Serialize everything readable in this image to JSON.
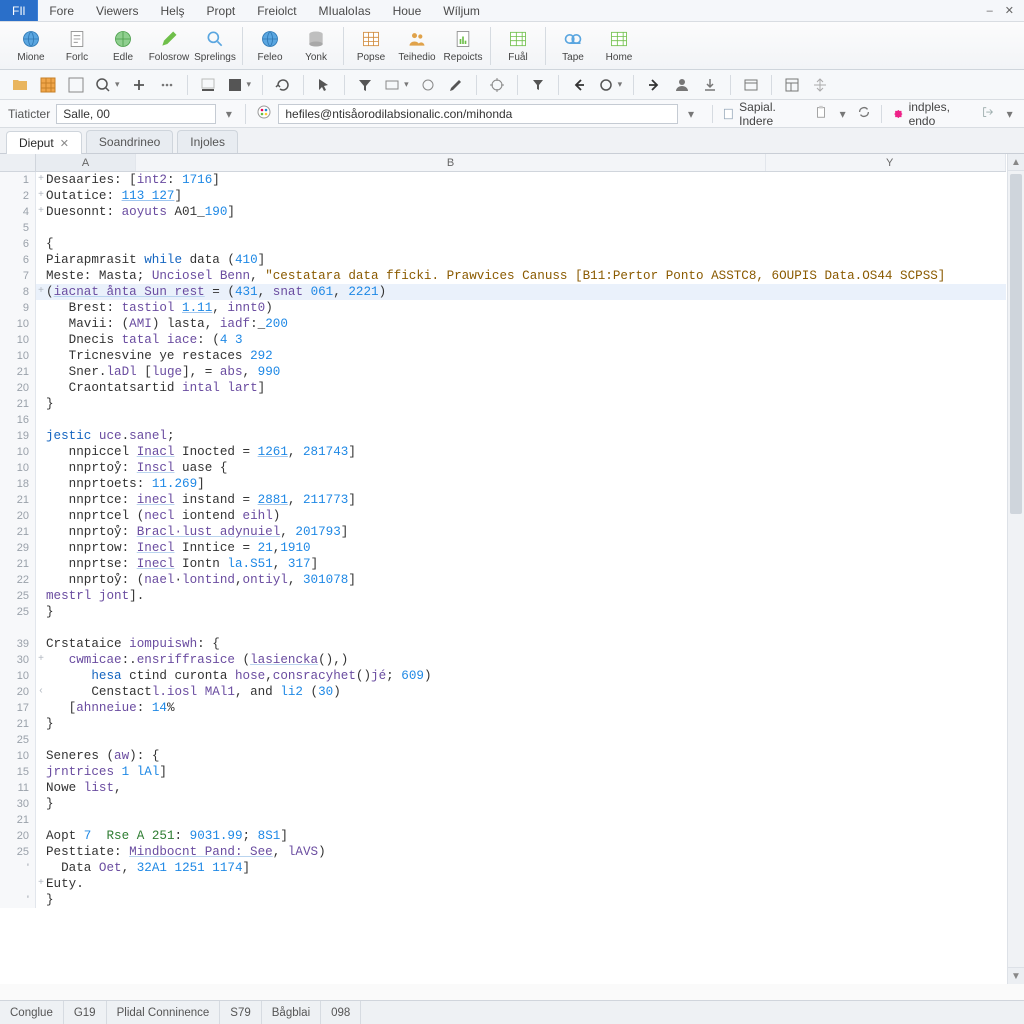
{
  "menu": {
    "file": "FIl",
    "items": [
      "Fore",
      "Viewers",
      "Helş",
      "Propt",
      "Freiolct",
      "MIualoIas",
      "Houe",
      "Wíljum"
    ]
  },
  "ribbon": [
    {
      "label": "Mione",
      "icon": "globe"
    },
    {
      "label": "Forlc",
      "icon": "doc"
    },
    {
      "label": "Edle",
      "icon": "globe2"
    },
    {
      "label": "Folosrow",
      "icon": "pen"
    },
    {
      "label": "Sprelings",
      "icon": "search"
    },
    {
      "label": "Feleo",
      "icon": "globe"
    },
    {
      "label": "Yonk",
      "icon": "db"
    },
    {
      "label": "Popse",
      "icon": "table"
    },
    {
      "label": "Teihedio",
      "icon": "people"
    },
    {
      "label": "Repoicts",
      "icon": "report"
    },
    {
      "label": "Fuål",
      "icon": "table2"
    },
    {
      "label": "Tape",
      "icon": "tape"
    },
    {
      "label": "Home",
      "icon": "table2"
    }
  ],
  "addr": {
    "label": "Tiaticter",
    "namebox": "Salle, 00",
    "url": "hefiles@ntisåorodilabsionalic.con/mihonda",
    "right1": "Sapial.  Indere",
    "right2": "indples, endo"
  },
  "tabs": [
    {
      "label": "Dieput",
      "active": true,
      "closable": true
    },
    {
      "label": "Soandrineo",
      "active": false,
      "closable": false
    },
    {
      "label": "Injoles",
      "active": false,
      "closable": false
    }
  ],
  "cols": {
    "a": "A",
    "b": "B",
    "y": "Y"
  },
  "lines": [
    {
      "n": "1",
      "g": "+",
      "code": [
        [
          "",
          "Desaaries: ["
        ],
        [
          "fn",
          "int2"
        ],
        [
          "",
          ": "
        ],
        [
          "num",
          "1716"
        ],
        [
          "",
          "]"
        ]
      ]
    },
    {
      "n": "2",
      "g": "+",
      "code": [
        [
          "",
          "Outatice: "
        ],
        [
          "num-link",
          "113 127"
        ],
        [
          "",
          "]"
        ]
      ]
    },
    {
      "n": "4",
      "g": "+",
      "code": [
        [
          "",
          "Duesonnt: "
        ],
        [
          "fn",
          "aoyuts"
        ],
        [
          "",
          " A01_"
        ],
        [
          "num",
          "190"
        ],
        [
          "",
          "]"
        ]
      ]
    },
    {
      "n": "5",
      "g": "",
      "code": [
        [
          "",
          ""
        ]
      ]
    },
    {
      "n": "6",
      "g": "",
      "code": [
        [
          "",
          "{"
        ]
      ]
    },
    {
      "n": "6",
      "g": "",
      "code": [
        [
          "",
          "Piarapmrasit "
        ],
        [
          "kw",
          "while"
        ],
        [
          "",
          " data ("
        ],
        [
          "num",
          "410"
        ],
        [
          "",
          "]"
        ]
      ]
    },
    {
      "n": "7",
      "g": "",
      "code": [
        [
          "",
          "Meste: Masta; "
        ],
        [
          "fn",
          "Unciosel Benn"
        ],
        [
          "",
          ", "
        ],
        [
          "str",
          "\"cestatara data fficki. Prawvices Canuss [B11:Pertor Ponto ASSTC8, 6OUPIS Data.OS44 SCPSS]"
        ]
      ]
    },
    {
      "n": "8",
      "g": "+",
      "hl": true,
      "code": [
        [
          "",
          "("
        ],
        [
          "fn ul",
          "iacnat ånta Sun rest"
        ],
        [
          "",
          " = ("
        ],
        [
          "num",
          "431"
        ],
        [
          "",
          ", "
        ],
        [
          "fn",
          "snat"
        ],
        [
          "",
          " "
        ],
        [
          "num",
          "061"
        ],
        [
          "",
          ", "
        ],
        [
          "num",
          "2221"
        ],
        [
          "",
          ")"
        ]
      ]
    },
    {
      "n": "9",
      "g": "",
      "code": [
        [
          "",
          "   Brest: "
        ],
        [
          "fn",
          "tastiol"
        ],
        [
          "",
          " "
        ],
        [
          "num-link",
          "1.11"
        ],
        [
          "",
          ", "
        ],
        [
          "fn",
          "innt0"
        ],
        [
          "",
          ")"
        ]
      ]
    },
    {
      "n": "10",
      "g": "",
      "code": [
        [
          "",
          "   Mavii: ("
        ],
        [
          "fn",
          "AMI"
        ],
        [
          "",
          ") lasta, "
        ],
        [
          "fn",
          "iadf"
        ],
        [
          "",
          ":_"
        ],
        [
          "num",
          "200"
        ]
      ]
    },
    {
      "n": "10",
      "g": "",
      "code": [
        [
          "",
          "   Dnecis "
        ],
        [
          "fn",
          "tatal iace"
        ],
        [
          "",
          ": ("
        ],
        [
          "num",
          "4 3"
        ]
      ]
    },
    {
      "n": "10",
      "g": "",
      "code": [
        [
          "",
          "   Tricnesvine ye restaces "
        ],
        [
          "num",
          "292"
        ]
      ]
    },
    {
      "n": "21",
      "g": "",
      "code": [
        [
          "",
          "   Sner."
        ],
        [
          "fn",
          "laDl"
        ],
        [
          "",
          " ["
        ],
        [
          "fn",
          "luge"
        ],
        [
          "",
          "], = "
        ],
        [
          "fn",
          "abs"
        ],
        [
          "",
          ", "
        ],
        [
          "num",
          "990"
        ]
      ]
    },
    {
      "n": "20",
      "g": "",
      "code": [
        [
          "",
          "   Craontatsartid "
        ],
        [
          "fn",
          "intal lart"
        ],
        [
          "",
          "]"
        ]
      ]
    },
    {
      "n": "21",
      "g": "",
      "code": [
        [
          "",
          "}"
        ]
      ]
    },
    {
      "n": "16",
      "g": "",
      "code": [
        [
          "",
          ""
        ]
      ]
    },
    {
      "n": "19",
      "g": "",
      "code": [
        [
          "kw",
          "jestic"
        ],
        [
          "",
          " "
        ],
        [
          "fn",
          "uce"
        ],
        [
          "",
          "."
        ],
        [
          "fn",
          "sanel"
        ],
        [
          "",
          ";"
        ]
      ]
    },
    {
      "n": "10",
      "g": "",
      "code": [
        [
          "",
          "   nnpiccel "
        ],
        [
          "fn ul",
          "Inacl"
        ],
        [
          "",
          " Inocted = "
        ],
        [
          "num-link",
          "1261"
        ],
        [
          "",
          ", "
        ],
        [
          "num",
          "281743"
        ],
        [
          "",
          "]"
        ]
      ]
    },
    {
      "n": "10",
      "g": "",
      "code": [
        [
          "",
          "   nnprtoẙ: "
        ],
        [
          "fn ul",
          "Inscl"
        ],
        [
          "",
          " uase {"
        ]
      ]
    },
    {
      "n": "18",
      "g": "",
      "code": [
        [
          "",
          "   nnprtoets: "
        ],
        [
          "num",
          "11.269"
        ],
        [
          "",
          "]"
        ]
      ]
    },
    {
      "n": "21",
      "g": "",
      "code": [
        [
          "",
          "   nnprtce: "
        ],
        [
          "fn ul",
          "inecl"
        ],
        [
          "",
          " instand = "
        ],
        [
          "num-link",
          "2881"
        ],
        [
          "",
          ", "
        ],
        [
          "num",
          "211773"
        ],
        [
          "",
          "]"
        ]
      ]
    },
    {
      "n": "20",
      "g": "",
      "code": [
        [
          "",
          "   nnprtcel ("
        ],
        [
          "fn",
          "necl"
        ],
        [
          "",
          " iontend "
        ],
        [
          "fn",
          "eihl"
        ],
        [
          "",
          ")"
        ]
      ]
    },
    {
      "n": "21",
      "g": "",
      "code": [
        [
          "",
          "   nnprtoẙ: "
        ],
        [
          "fn ul",
          "Bracl·lust adynuiel"
        ],
        [
          "",
          ", "
        ],
        [
          "num",
          "201793"
        ],
        [
          "",
          "]"
        ]
      ]
    },
    {
      "n": "29",
      "g": "",
      "code": [
        [
          "",
          "   nnprtow: "
        ],
        [
          "fn ul",
          "Inecl"
        ],
        [
          "",
          " Inntice = "
        ],
        [
          "num",
          "21"
        ],
        [
          "",
          ","
        ],
        [
          "num",
          "1910"
        ]
      ]
    },
    {
      "n": "21",
      "g": "",
      "code": [
        [
          "",
          "   nnprtse: "
        ],
        [
          "fn ul",
          "Inecl"
        ],
        [
          "",
          " Iontn "
        ],
        [
          "num",
          "la.S51"
        ],
        [
          "",
          ", "
        ],
        [
          "num",
          "317"
        ],
        [
          "",
          "]"
        ]
      ]
    },
    {
      "n": "22",
      "g": "",
      "code": [
        [
          "",
          "   nnprtoẙ: ("
        ],
        [
          "fn",
          "nael"
        ],
        [
          "",
          "·"
        ],
        [
          "fn",
          "lontind"
        ],
        [
          "",
          ","
        ],
        [
          "fn",
          "ontiyl"
        ],
        [
          "",
          ", "
        ],
        [
          "num",
          "301078"
        ],
        [
          "",
          "]"
        ]
      ]
    },
    {
      "n": "25",
      "g": "",
      "code": [
        [
          "fn",
          "mestrl jont"
        ],
        [
          "",
          "]."
        ]
      ]
    },
    {
      "n": "25",
      "g": "",
      "code": [
        [
          "",
          "}"
        ]
      ]
    },
    {
      "n": "",
      "g": "",
      "code": [
        [
          "",
          ""
        ]
      ]
    },
    {
      "n": "39",
      "g": "",
      "code": [
        [
          "",
          "Crstataice "
        ],
        [
          "fn",
          "iompuiswh"
        ],
        [
          "",
          ": {"
        ]
      ]
    },
    {
      "n": "30",
      "g": "+",
      "code": [
        [
          "",
          "   "
        ],
        [
          "fn",
          "cwmicae"
        ],
        [
          "",
          ":."
        ],
        [
          "fn",
          "ensriffrasice"
        ],
        [
          "",
          " ("
        ],
        [
          "fn ul",
          "lasiencka"
        ],
        [
          "",
          "(),)"
        ]
      ]
    },
    {
      "n": "10",
      "g": "",
      "code": [
        [
          "",
          "      "
        ],
        [
          "kw",
          "hesa"
        ],
        [
          "",
          " ctind curonta "
        ],
        [
          "fn",
          "hose"
        ],
        [
          "",
          ","
        ],
        [
          "fn",
          "consracyhet"
        ],
        [
          "",
          "()"
        ],
        [
          "fn",
          "jé"
        ],
        [
          "",
          "; "
        ],
        [
          "num",
          "609"
        ],
        [
          "",
          ")"
        ]
      ]
    },
    {
      "n": "20",
      "g": "‹",
      "code": [
        [
          "",
          "      Censtact"
        ],
        [
          "fn",
          "l.iosl MAl1"
        ],
        [
          "",
          ", and "
        ],
        [
          "num",
          "li2"
        ],
        [
          "",
          " ("
        ],
        [
          "num",
          "30"
        ],
        [
          "",
          ")"
        ]
      ]
    },
    {
      "n": "17",
      "g": "",
      "code": [
        [
          "",
          "   ["
        ],
        [
          "fn",
          "ahnneiue"
        ],
        [
          "",
          ": "
        ],
        [
          "num",
          "14"
        ],
        [
          "",
          "%"
        ]
      ]
    },
    {
      "n": "21",
      "g": "",
      "code": [
        [
          "",
          "}"
        ]
      ]
    },
    {
      "n": "25",
      "g": "",
      "code": [
        [
          "",
          ""
        ]
      ]
    },
    {
      "n": "10",
      "g": "",
      "code": [
        [
          "",
          "Seneres ("
        ],
        [
          "fn",
          "aw"
        ],
        [
          "",
          "): {"
        ]
      ]
    },
    {
      "n": "15",
      "g": "",
      "code": [
        [
          "fn",
          "jrntrices"
        ],
        [
          "",
          " "
        ],
        [
          "num",
          "1 lAl"
        ],
        [
          "",
          "]"
        ]
      ]
    },
    {
      "n": "11",
      "g": "",
      "code": [
        [
          "",
          "Nowe "
        ],
        [
          "fn",
          "list"
        ],
        [
          "",
          ","
        ]
      ]
    },
    {
      "n": "30",
      "g": "",
      "code": [
        [
          "",
          "}"
        ]
      ]
    },
    {
      "n": "21",
      "g": "",
      "code": [
        [
          "",
          ""
        ]
      ]
    },
    {
      "n": "20",
      "g": "",
      "code": [
        [
          "",
          "Aopt "
        ],
        [
          "num",
          "7"
        ],
        [
          "",
          "  "
        ],
        [
          "ref",
          "Rse A 251"
        ],
        [
          "",
          ": "
        ],
        [
          "num",
          "9031.99"
        ],
        [
          "",
          "; "
        ],
        [
          "num",
          "8S1"
        ],
        [
          "",
          "]"
        ]
      ]
    },
    {
      "n": "25",
      "g": "",
      "code": [
        [
          "",
          "Pesttiate: "
        ],
        [
          "fn ul",
          "Mindbocnt Pand: See"
        ],
        [
          "",
          ", "
        ],
        [
          "fn",
          "lAVS"
        ],
        [
          "",
          ")"
        ]
      ]
    },
    {
      "n": "'",
      "g": "",
      "code": [
        [
          "",
          "  Data "
        ],
        [
          "fn",
          "Oet"
        ],
        [
          "",
          ", "
        ],
        [
          "num",
          "32A1 1251 1174"
        ],
        [
          "",
          "]"
        ]
      ]
    },
    {
      "n": "",
      "g": "+",
      "code": [
        [
          "",
          "Euty."
        ]
      ]
    },
    {
      "n": "'",
      "g": "",
      "code": [
        [
          "",
          "}"
        ]
      ]
    }
  ],
  "status": {
    "cells": [
      "Conglue",
      "G19",
      "Plidal Conninence",
      "S79",
      "Bågblai",
      "098"
    ]
  }
}
